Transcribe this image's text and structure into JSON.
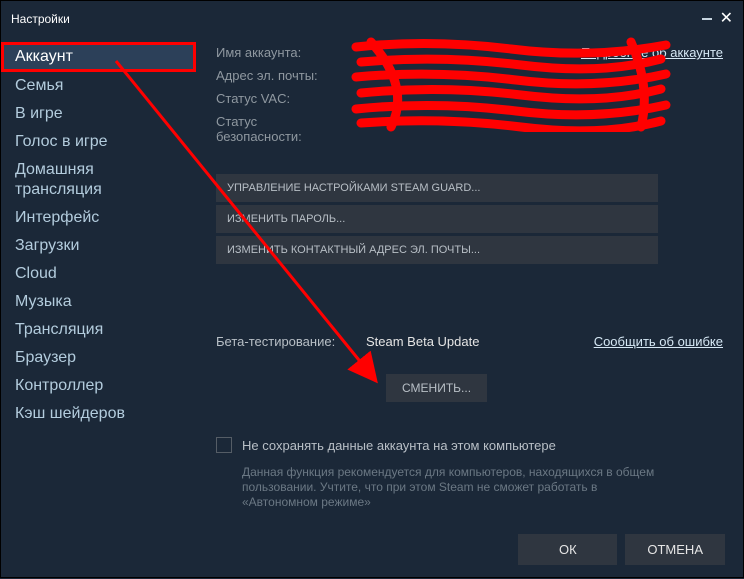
{
  "window": {
    "title": "Настройки"
  },
  "sidebar": {
    "items": [
      {
        "label": "Аккаунт",
        "active": true
      },
      {
        "label": "Семья"
      },
      {
        "label": "В игре"
      },
      {
        "label": "Голос в игре"
      },
      {
        "label": "Домашняя трансляция"
      },
      {
        "label": "Интерфейс"
      },
      {
        "label": "Загрузки"
      },
      {
        "label": "Cloud"
      },
      {
        "label": "Музыка"
      },
      {
        "label": "Трансляция"
      },
      {
        "label": "Браузер"
      },
      {
        "label": "Контроллер"
      },
      {
        "label": "Кэш шейдеров"
      }
    ]
  },
  "account": {
    "name_label": "Имя аккаунта:",
    "email_label": "Адрес эл. почты:",
    "vac_label": "Статус VAC:",
    "security_label": "Статус безопасности:",
    "more_link": "Подробнее об аккаунте"
  },
  "buttons": {
    "guard": "УПРАВЛЕНИЕ НАСТРОЙКАМИ STEAM GUARD...",
    "password": "ИЗМЕНИТЬ ПАРОЛЬ...",
    "email": "ИЗМЕНИТЬ КОНТАКТНЫЙ АДРЕС ЭЛ. ПОЧТЫ..."
  },
  "beta": {
    "label": "Бета-тестирование:",
    "value": "Steam Beta Update",
    "report_link": "Сообщить об ошибке",
    "change": "СМЕНИТЬ..."
  },
  "checkbox": {
    "label": "Не сохранять данные аккаунта на этом компьютере",
    "hint": "Данная функция рекомендуется для компьютеров, находящихся в общем пользовании. Учтите, что при этом Steam не сможет работать в «Автономном режиме»"
  },
  "footer": {
    "ok": "ОК",
    "cancel": "ОТМЕНА"
  }
}
